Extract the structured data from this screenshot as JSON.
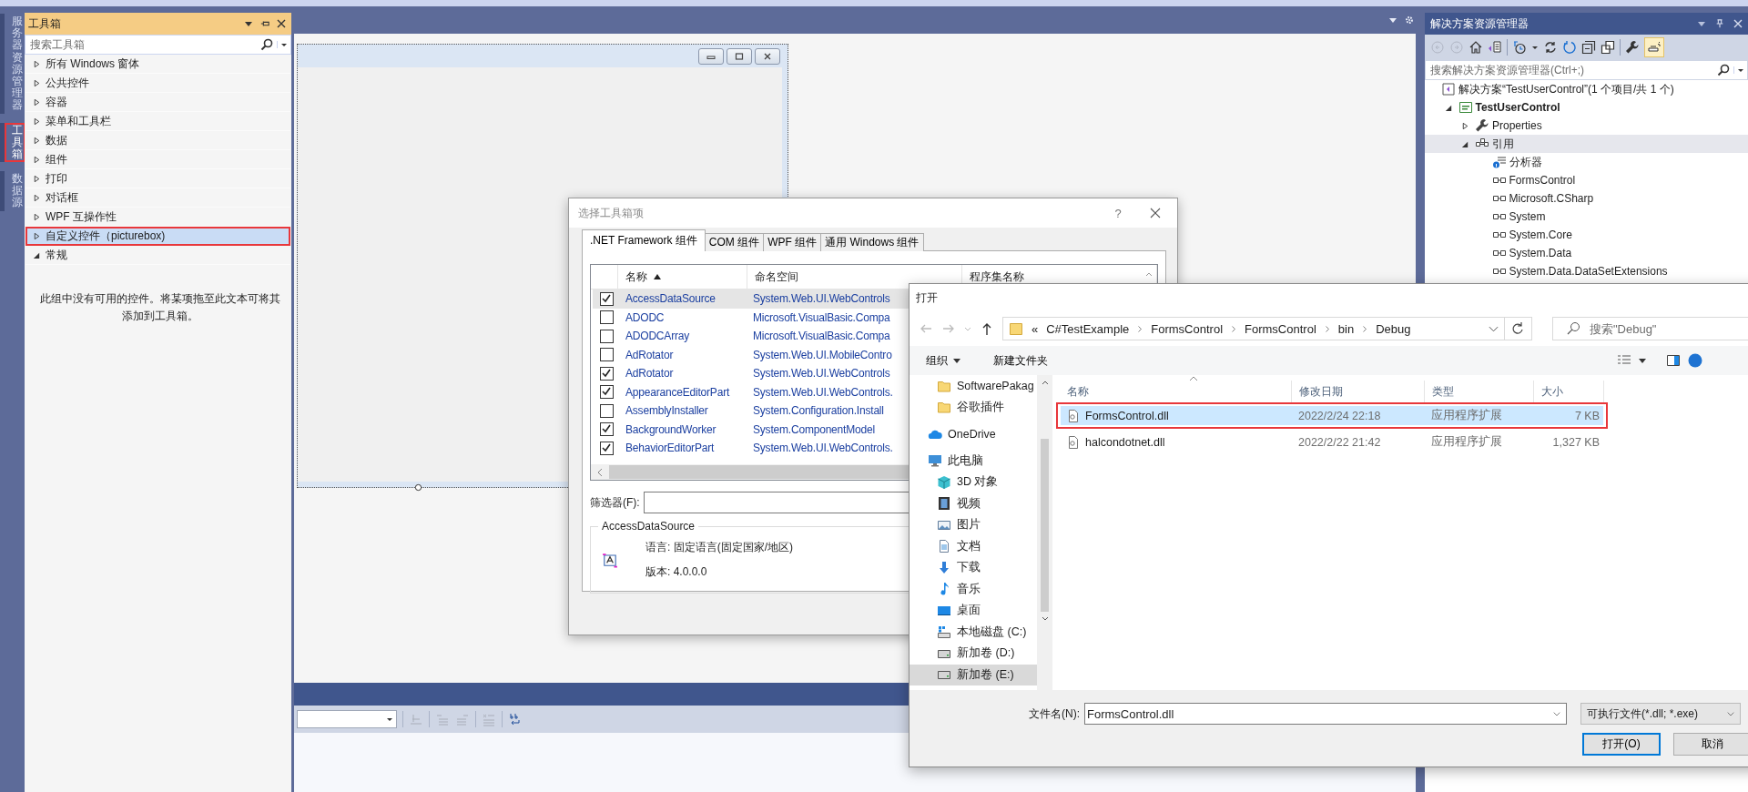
{
  "side_tabs": [
    {
      "label": "服务器资源管理器",
      "selected": false,
      "highlighted": false
    },
    {
      "label": "工具箱",
      "selected": true,
      "highlighted": true
    },
    {
      "label": "数据源",
      "selected": false,
      "highlighted": false
    }
  ],
  "toolbox": {
    "title": "工具箱",
    "search": {
      "placeholder": "搜索工具箱"
    },
    "groups": [
      {
        "label": "所有 Windows 窗体",
        "expanded": false,
        "selected": false,
        "highlighted": false
      },
      {
        "label": "公共控件",
        "expanded": false,
        "selected": false,
        "highlighted": false
      },
      {
        "label": "容器",
        "expanded": false,
        "selected": false,
        "highlighted": false
      },
      {
        "label": "菜单和工具栏",
        "expanded": false,
        "selected": false,
        "highlighted": false
      },
      {
        "label": "数据",
        "expanded": false,
        "selected": false,
        "highlighted": false
      },
      {
        "label": "组件",
        "expanded": false,
        "selected": false,
        "highlighted": false
      },
      {
        "label": "打印",
        "expanded": false,
        "selected": false,
        "highlighted": false
      },
      {
        "label": "对话框",
        "expanded": false,
        "selected": false,
        "highlighted": false
      },
      {
        "label": "WPF 互操作性",
        "expanded": false,
        "selected": false,
        "highlighted": false
      },
      {
        "label": "自定义控件（picturebox)",
        "expanded": false,
        "selected": true,
        "highlighted": true
      },
      {
        "label": "常规",
        "expanded": true,
        "selected": false,
        "highlighted": false
      }
    ],
    "empty_message": "此组中没有可用的控件。将某项拖至此文本可将其添加到工具箱。"
  },
  "explorer": {
    "title": "解决方案资源管理器",
    "search": {
      "placeholder": "搜索解决方案资源管理器(Ctrl+;)"
    },
    "tree": [
      {
        "kind": "solution",
        "label": "解决方案“TestUserControl”(1 个项目/共 1 个)",
        "selected": false,
        "children": [
          {
            "kind": "project",
            "label": "TestUserControl",
            "expanded": true,
            "selected": false,
            "children": [
              {
                "kind": "properties",
                "label": "Properties",
                "expanded": false,
                "selected": false
              },
              {
                "kind": "references",
                "label": "引用",
                "expanded": true,
                "selected": true,
                "children": [
                  {
                    "kind": "analyzer",
                    "label": "分析器",
                    "selected": false
                  },
                  {
                    "kind": "reference",
                    "label": "FormsControl",
                    "selected": false
                  },
                  {
                    "kind": "reference",
                    "label": "Microsoft.CSharp",
                    "selected": false
                  },
                  {
                    "kind": "reference",
                    "label": "System",
                    "selected": false
                  },
                  {
                    "kind": "reference",
                    "label": "System.Core",
                    "selected": false
                  },
                  {
                    "kind": "reference",
                    "label": "System.Data",
                    "selected": false
                  },
                  {
                    "kind": "reference",
                    "label": "System.Data.DataSetExtensions",
                    "selected": false
                  }
                ]
              }
            ]
          }
        ]
      }
    ]
  },
  "choose_dialog": {
    "title": "选择工具箱项",
    "help": "?",
    "tabs": [
      {
        "label": ".NET Framework 组件",
        "selected": true
      },
      {
        "label": "COM 组件",
        "selected": false
      },
      {
        "label": "WPF 组件",
        "selected": false
      },
      {
        "label": "通用 Windows 组件",
        "selected": false
      }
    ],
    "columns": [
      {
        "label": "名称",
        "sorted": true
      },
      {
        "label": "命名空间",
        "sorted": false
      },
      {
        "label": "程序集名称",
        "sorted": false
      }
    ],
    "rows": [
      {
        "checked": true,
        "selected": true,
        "name": "AccessDataSource",
        "namespace": "System.Web.UI.WebControls"
      },
      {
        "checked": false,
        "selected": false,
        "name": "ADODC",
        "namespace": "Microsoft.VisualBasic.Compa"
      },
      {
        "checked": false,
        "selected": false,
        "name": "ADODCArray",
        "namespace": "Microsoft.VisualBasic.Compa"
      },
      {
        "checked": false,
        "selected": false,
        "name": "AdRotator",
        "namespace": "System.Web.UI.MobileContro"
      },
      {
        "checked": true,
        "selected": false,
        "name": "AdRotator",
        "namespace": "System.Web.UI.WebControls"
      },
      {
        "checked": true,
        "selected": false,
        "name": "AppearanceEditorPart",
        "namespace": "System.Web.UI.WebControls."
      },
      {
        "checked": false,
        "selected": false,
        "name": "AssemblyInstaller",
        "namespace": "System.Configuration.Install"
      },
      {
        "checked": true,
        "selected": false,
        "name": "BackgroundWorker",
        "namespace": "System.ComponentModel"
      },
      {
        "checked": true,
        "selected": false,
        "name": "BehaviorEditorPart",
        "namespace": "System.Web.UI.WebControls."
      }
    ],
    "filter": {
      "label": "筛选器(F):"
    },
    "details": {
      "title": "AccessDataSource",
      "language": "语言: 固定语言(固定国家/地区)",
      "version": "版本: 4.0.0.0"
    }
  },
  "open_dialog": {
    "title": "打开",
    "path_prefix": "«",
    "path": [
      "C#TestExample",
      "FormsControl",
      "FormsControl",
      "bin",
      "Debug"
    ],
    "search": {
      "placeholder": "搜索\"Debug\""
    },
    "toolbar": {
      "organize": "组织",
      "new_folder": "新建文件夹"
    },
    "nav": {
      "quick_access": [
        {
          "kind": "folder",
          "label": "SoftwarePakag",
          "selected": false
        },
        {
          "kind": "folder",
          "label": "谷歌插件",
          "selected": false
        }
      ],
      "places": [
        {
          "kind": "cloud",
          "label": "OneDrive",
          "selected": false
        },
        {
          "kind": "computer",
          "label": "此电脑",
          "selected": false,
          "children": [
            {
              "kind": "cube",
              "label": "3D 对象",
              "selected": false
            },
            {
              "kind": "video",
              "label": "视频",
              "selected": false
            },
            {
              "kind": "image",
              "label": "图片",
              "selected": false
            },
            {
              "kind": "document",
              "label": "文档",
              "selected": false
            },
            {
              "kind": "download",
              "label": "下载",
              "selected": false
            },
            {
              "kind": "music",
              "label": "音乐",
              "selected": false
            },
            {
              "kind": "desktop",
              "label": "桌面",
              "selected": false
            },
            {
              "kind": "system_drive",
              "label": "本地磁盘 (C:)",
              "selected": false
            },
            {
              "kind": "drive",
              "label": "新加卷 (D:)",
              "selected": false
            },
            {
              "kind": "drive",
              "label": "新加卷 (E:)",
              "selected": true
            }
          ]
        }
      ]
    },
    "columns": [
      "名称",
      "修改日期",
      "类型",
      "大小"
    ],
    "files": [
      {
        "name": "FormsControl.dll",
        "modified": "2022/2/24 22:18",
        "type": "应用程序扩展",
        "size": "7 KB",
        "selected": true,
        "highlighted": true
      },
      {
        "name": "halcondotnet.dll",
        "modified": "2022/2/22 21:42",
        "type": "应用程序扩展",
        "size": "1,327 KB",
        "selected": false,
        "highlighted": false
      }
    ],
    "file_name": {
      "label": "文件名(N):",
      "value": "FormsControl.dll"
    },
    "file_type": "可执行文件(*.dll; *.exe)",
    "buttons": [
      {
        "label": "打开(O)",
        "default": true
      },
      {
        "label": "取消",
        "default": false
      }
    ]
  }
}
